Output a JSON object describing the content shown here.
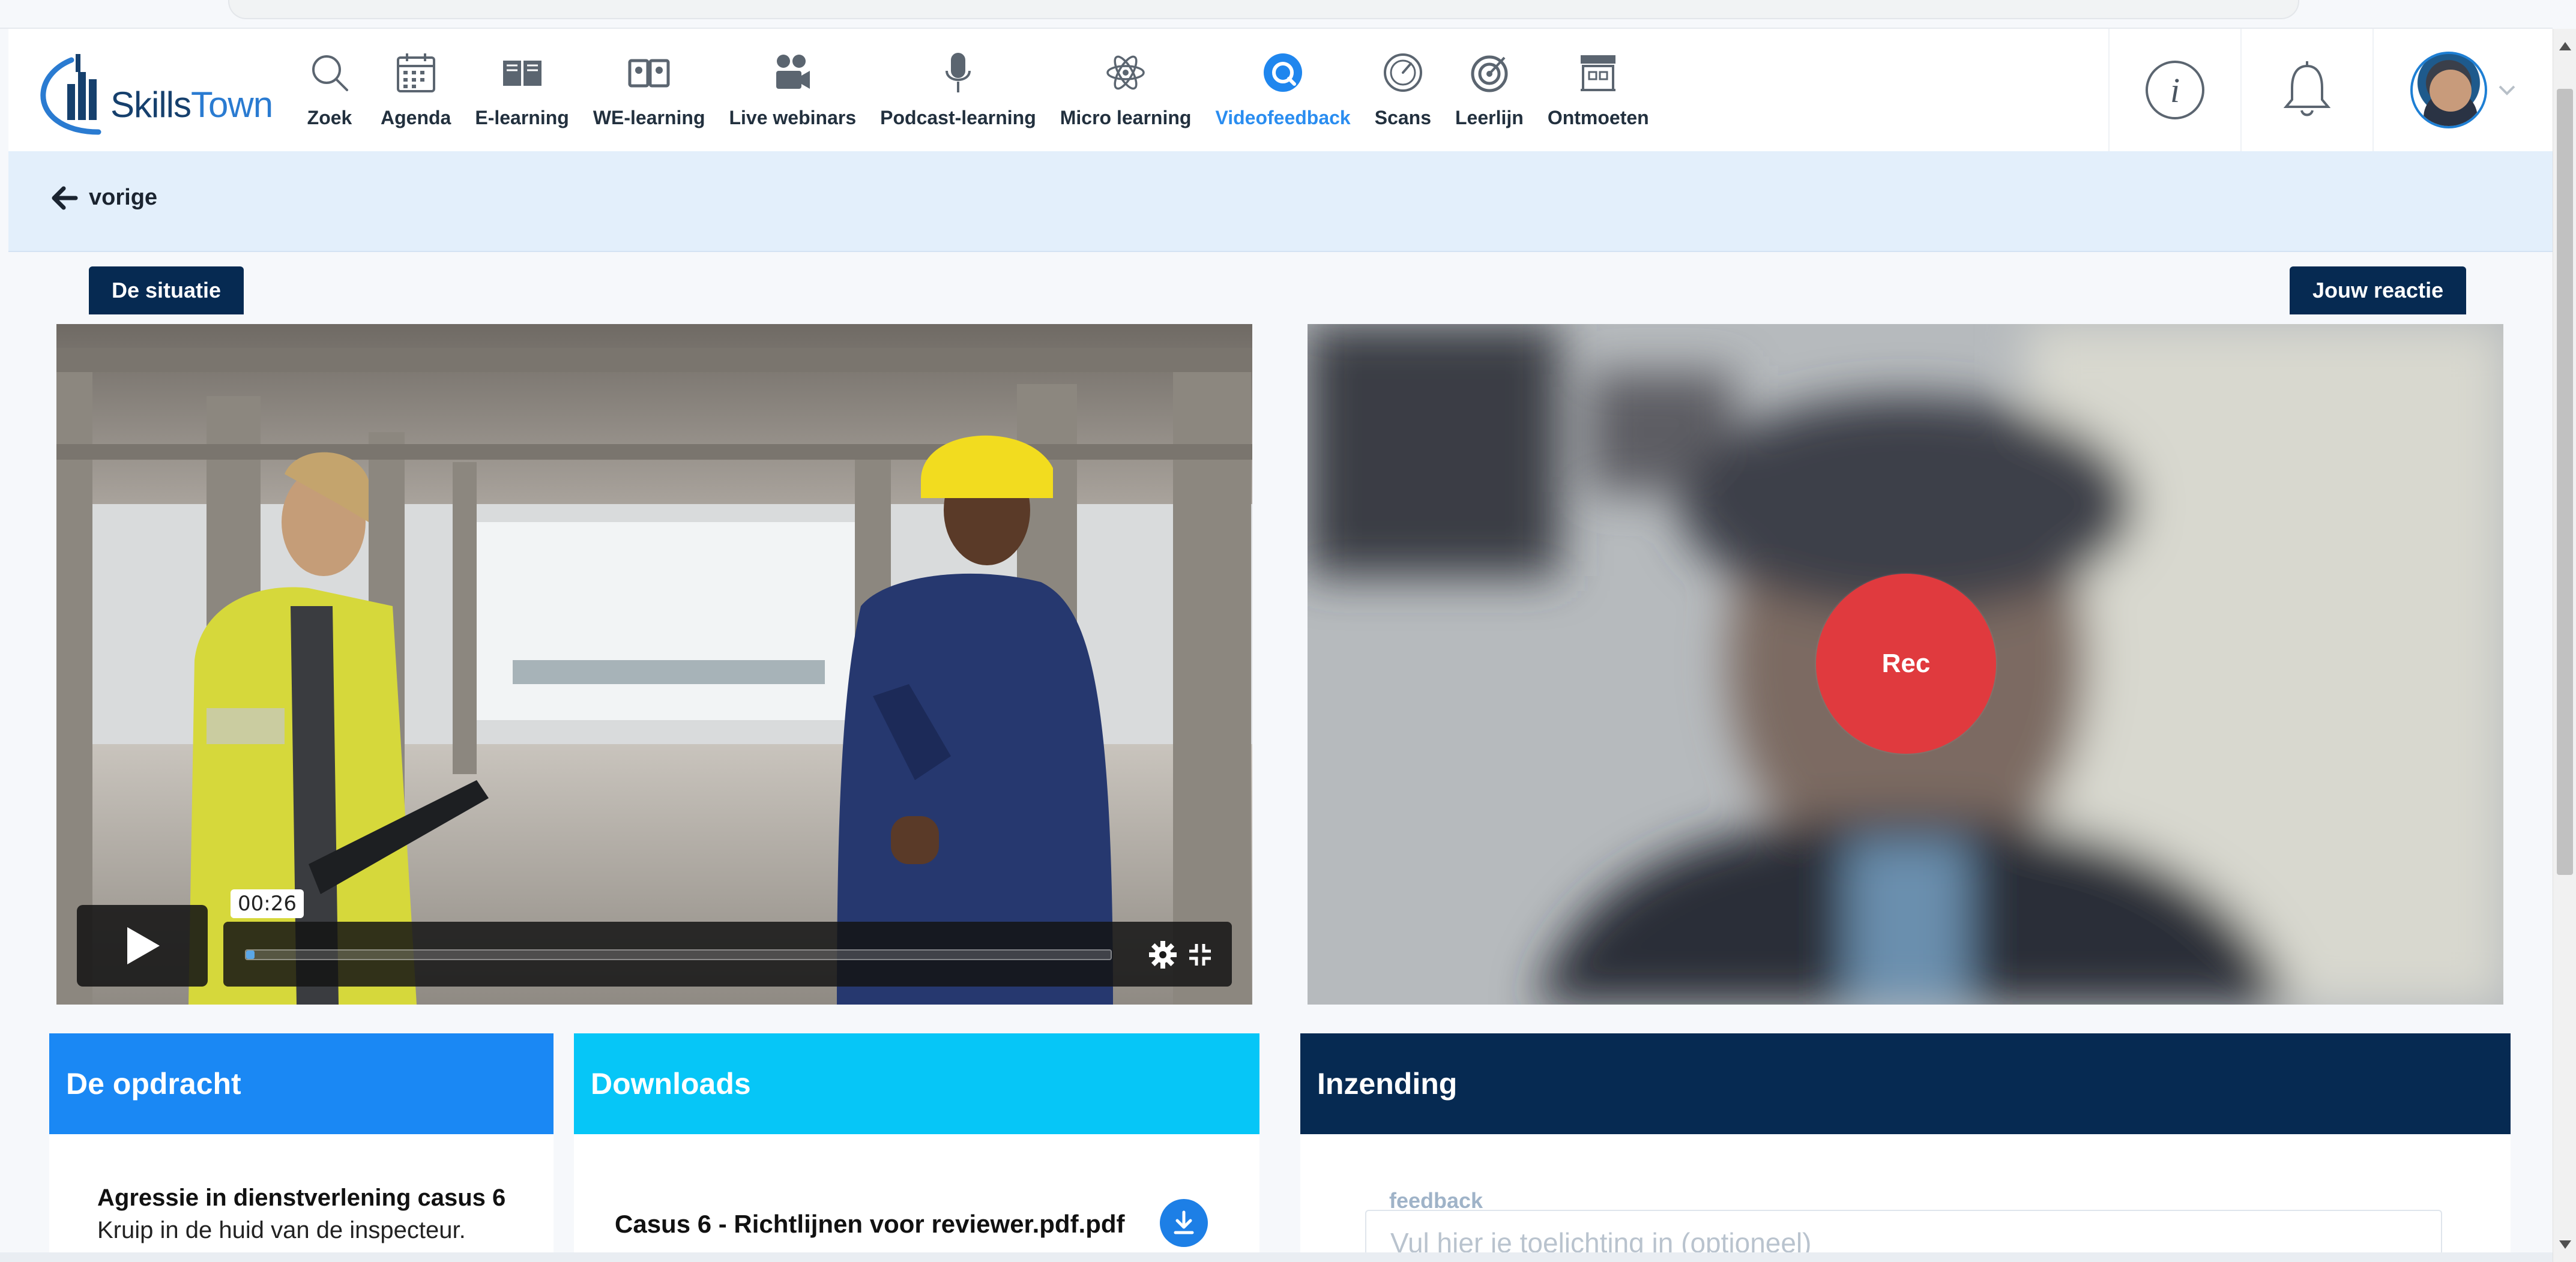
{
  "header": {
    "logo_text_1": "Skills",
    "logo_text_2": "Town",
    "nav": [
      {
        "label": "Zoek",
        "icon": "search-icon"
      },
      {
        "label": "Agenda",
        "icon": "calendar-icon"
      },
      {
        "label": "E-learning",
        "icon": "book-icon"
      },
      {
        "label": "WE-learning",
        "icon": "open-book-icon"
      },
      {
        "label": "Live webinars",
        "icon": "video-camera-icon"
      },
      {
        "label": "Podcast-learning",
        "icon": "microphone-icon"
      },
      {
        "label": "Micro learning",
        "icon": "atom-icon"
      },
      {
        "label": "Videofeedback",
        "icon": "videofeedback-icon",
        "active": true
      },
      {
        "label": "Scans",
        "icon": "gauge-icon"
      },
      {
        "label": "Leerlijn",
        "icon": "target-icon"
      },
      {
        "label": "Ontmoeten",
        "icon": "store-icon"
      }
    ],
    "right_icons": [
      "info-icon",
      "bell-icon",
      "avatar"
    ]
  },
  "backbar": {
    "label": "vorige"
  },
  "tags": {
    "situation": "De situatie",
    "reaction": "Jouw reactie"
  },
  "video": {
    "time": "00:26",
    "progress_fraction": 0.01
  },
  "webcam": {
    "rec_label": "Rec"
  },
  "cards": {
    "opdracht": {
      "title": "De opdracht",
      "task_title": "Agressie in dienstverlening casus 6",
      "task_sub": "Kruip in de huid van de inspecteur."
    },
    "downloads": {
      "title": "Downloads",
      "file": "Casus 6 - Richtlijnen voor reviewer.pdf.pdf"
    },
    "inzending": {
      "title": "Inzending",
      "field_label": "feedback",
      "placeholder": "Vul hier je toelichting in (optioneel)"
    }
  },
  "colors": {
    "accent": "#2a8df0",
    "navy": "#062a52",
    "opdracht_head": "#1a88f4",
    "downloads_head": "#06c6f7",
    "inzending_head": "#062a52",
    "rec": "#e03a3e"
  }
}
